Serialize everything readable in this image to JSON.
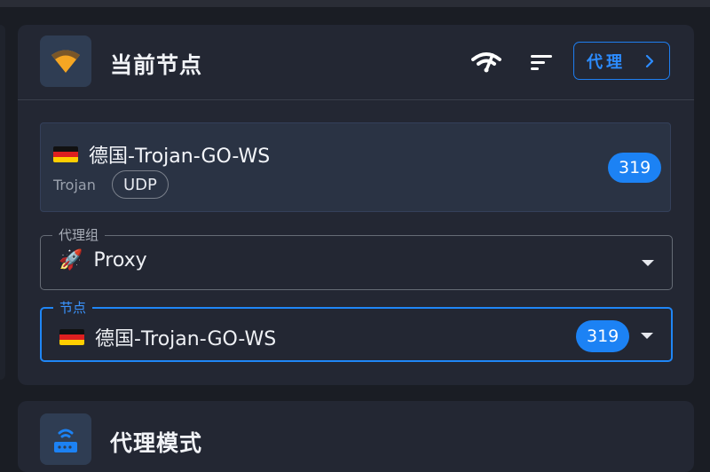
{
  "current_node_card": {
    "title": "当前节点",
    "proxy_button_label": "代理",
    "node": {
      "name": "德国-Trojan-GO-WS",
      "type": "Trojan",
      "udp_label": "UDP",
      "latency": "319"
    },
    "proxy_group_select": {
      "label": "代理组",
      "value": "Proxy",
      "value_icon": "🚀"
    },
    "node_select": {
      "label": "节点",
      "value": "德国-Trojan-GO-WS",
      "latency": "319"
    }
  },
  "proxy_mode_card": {
    "title": "代理模式"
  },
  "icons": {
    "card_icon": "wifi-fan-icon",
    "signal": "wifi-signal-icon",
    "sort": "sort-icon",
    "chevron": "chevron-right-icon",
    "flag": "germany-flag-icon",
    "mode_icon": "router-icon"
  },
  "colors": {
    "accent": "#1c82f4",
    "card_bg": "#232733",
    "page_bg": "#1a1d24",
    "icon_orange": "#f5a623"
  }
}
